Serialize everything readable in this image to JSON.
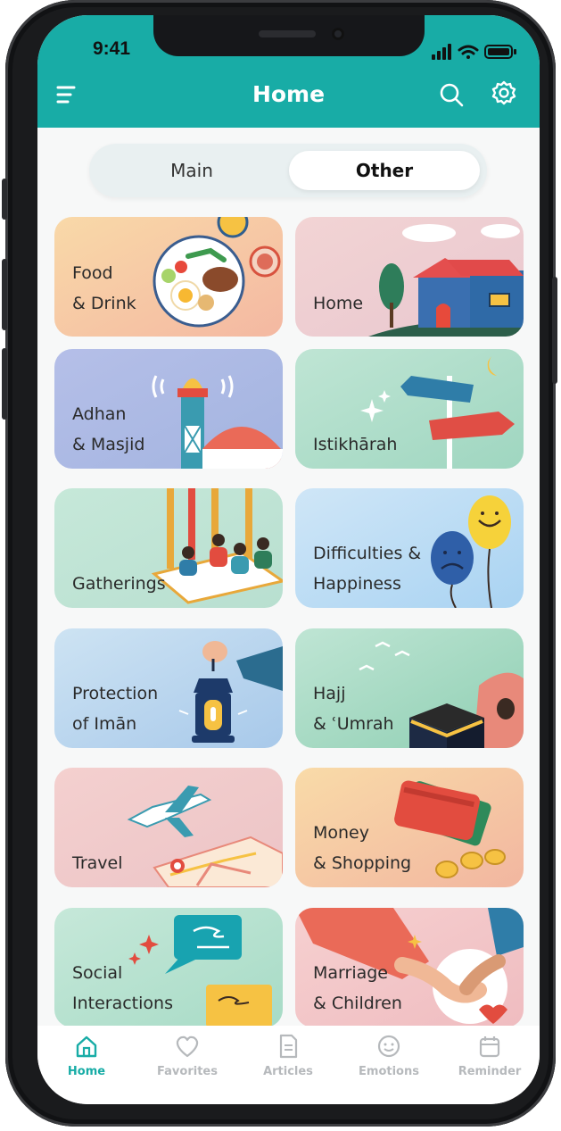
{
  "status_bar": {
    "time": "9:41"
  },
  "header": {
    "title": "Home",
    "menu_icon": "menu-icon",
    "search_icon": "search-icon",
    "settings_icon": "gear-icon",
    "color": "#18aca6"
  },
  "segments": {
    "main_label": "Main",
    "other_label": "Other",
    "selected": "Other"
  },
  "categories": [
    {
      "line1": "Food",
      "line2": "& Drink"
    },
    {
      "line1": "Home",
      "line2": ""
    },
    {
      "line1": "Adhan",
      "line2": "& Masjid"
    },
    {
      "line1": "Istikhārah",
      "line2": ""
    },
    {
      "line1": "Gatherings",
      "line2": ""
    },
    {
      "line1": "Difficulties &",
      "line2": "Happiness"
    },
    {
      "line1": "Protection",
      "line2": "of Imān"
    },
    {
      "line1": "Hajj",
      "line2": "& ʿUmrah"
    },
    {
      "line1": "Travel",
      "line2": ""
    },
    {
      "line1": "Money",
      "line2": "& Shopping"
    },
    {
      "line1": "Social",
      "line2": "Interactions"
    },
    {
      "line1": "Marriage",
      "line2": "& Children"
    }
  ],
  "tabs": [
    {
      "label": "Home",
      "icon": "home-icon",
      "active": true
    },
    {
      "label": "Favorites",
      "icon": "heart-icon",
      "active": false
    },
    {
      "label": "Articles",
      "icon": "document-icon",
      "active": false
    },
    {
      "label": "Emotions",
      "icon": "smiley-icon",
      "active": false
    },
    {
      "label": "Reminder",
      "icon": "calendar-icon",
      "active": false
    }
  ]
}
